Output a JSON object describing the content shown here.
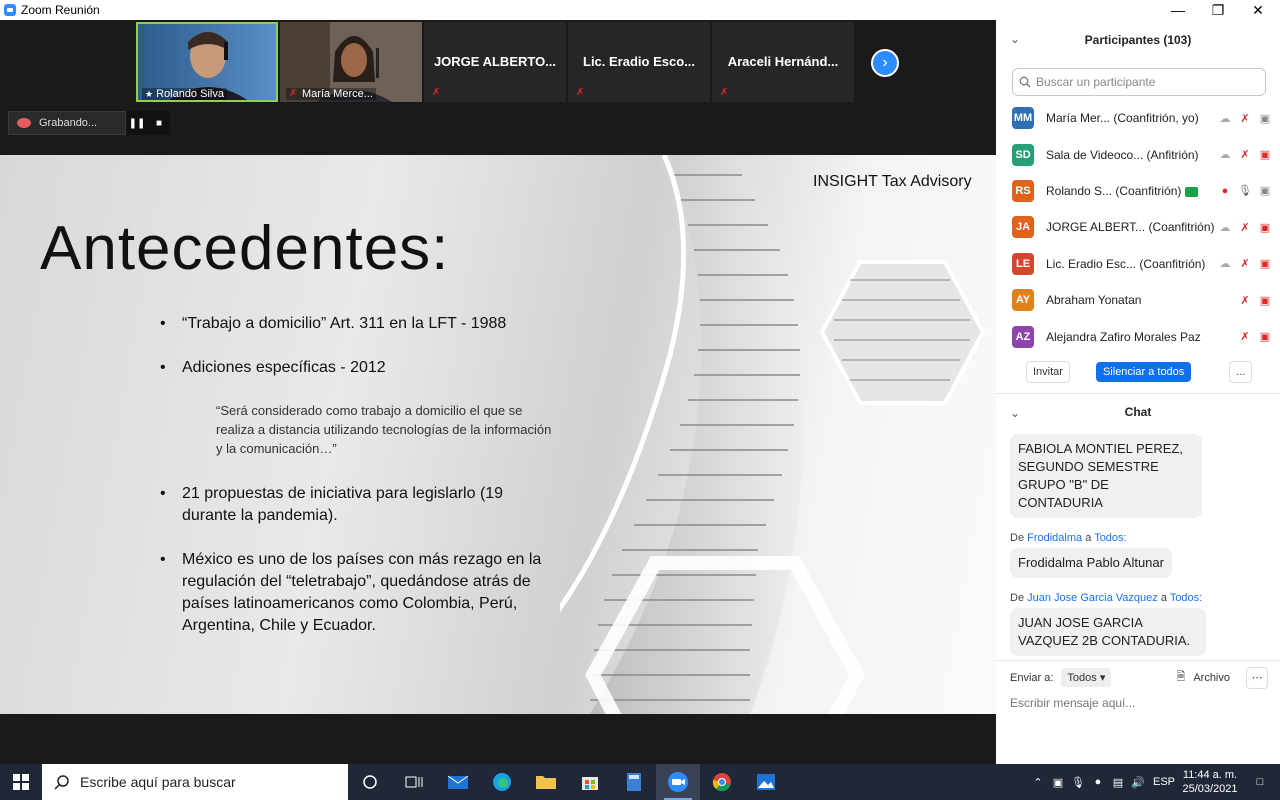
{
  "window": {
    "title": "Zoom Reunión"
  },
  "gallery": {
    "tiles": [
      {
        "name": "Rolando Silva",
        "type": "video"
      },
      {
        "name": "María Merce...",
        "type": "video"
      },
      {
        "name": "JORGE ALBERTO...",
        "type": "name"
      },
      {
        "name": "Lic. Eradio Esco...",
        "type": "name"
      },
      {
        "name": "Araceli Hernánd...",
        "type": "name"
      }
    ]
  },
  "recording": {
    "label": "Grabando..."
  },
  "slide": {
    "brand": "INSIGHT Tax Advisory",
    "heading": "Antecedentes:",
    "bullets": [
      "“Trabajo a domicilio” Art. 311 en la LFT - 1988",
      "Adiciones específicas - 2012",
      "21 propuestas de iniciativa para legislarlo (19 durante la pandemia).",
      "México es uno de los países con más rezago en la regulación del “teletrabajo”, quedándose atrás de países latinoamericanos como Colombia, Perú, Argentina, Chile y Ecuador."
    ],
    "quote": "“Será considerado como trabajo a domicilio el que se realiza a distancia utilizando tecnologías de la información y la comunicación…”"
  },
  "participants": {
    "header": "Participantes (103)",
    "search_placeholder": "Buscar un participante",
    "list": [
      {
        "initials": "MM",
        "color": "#2f6fb5",
        "name": "María Mer...",
        "role": "(Coanfitrión, yo)"
      },
      {
        "initials": "SD",
        "color": "#27a079",
        "name": "Sala de Videoco...",
        "role": "(Anfitrión)"
      },
      {
        "initials": "RS",
        "color": "#e0621b",
        "name": "Rolando S...",
        "role": "(Coanfitrión)"
      },
      {
        "initials": "JA",
        "color": "#e0621b",
        "name": "JORGE ALBERT...",
        "role": "(Coanfitrión)"
      },
      {
        "initials": "LE",
        "color": "#d6452f",
        "name": "Lic. Eradio Esc...",
        "role": "(Coanfitrión)"
      },
      {
        "initials": "AY",
        "color": "#e0801b",
        "name": "Abraham Yonatan",
        "role": ""
      },
      {
        "initials": "AZ",
        "color": "#8e44ad",
        "name": "Alejandra Zafiro Morales Paz",
        "role": ""
      }
    ],
    "invite_label": "Invitar",
    "mute_all_label": "Silenciar a todos",
    "more_label": "..."
  },
  "chat": {
    "header": "Chat",
    "messages": [
      {
        "from": "",
        "to": "",
        "text": "FABIOLA MONTIEL PEREZ, SEGUNDO SEMESTRE GRUPO \"B\" DE CONTADURIA"
      },
      {
        "from": "Frodidalma",
        "to": "Todos:",
        "text": "Frodidalma Pablo Altunar"
      },
      {
        "from": "Juan Jose Garcia Vazquez",
        "to": "Todos:",
        "text": "JUAN JOSE GARCIA VAZQUEZ 2B CONTADURIA."
      }
    ],
    "send_to_label": "Enviar a:",
    "send_to_value": "Todos",
    "file_label": "Archivo",
    "input_placeholder": "Escribir mensaje aquí..."
  },
  "taskbar": {
    "search_placeholder": "Escribe aquí para buscar",
    "lang": "ESP",
    "time": "11:44 a. m.",
    "date": "25/03/2021"
  }
}
